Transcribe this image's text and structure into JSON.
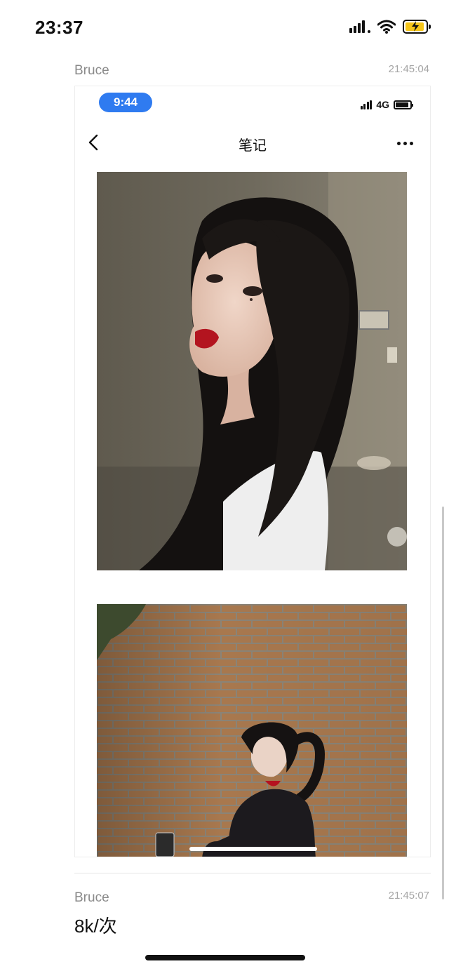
{
  "status_bar": {
    "time": "23:37"
  },
  "messages": [
    {
      "sender": "Bruce",
      "time": "21:45:04"
    },
    {
      "sender": "Bruce",
      "time": "21:45:07",
      "text": "8k/次"
    }
  ],
  "shared_screenshot": {
    "status_time": "9:44",
    "network": "4G",
    "nav_title": "笔记"
  },
  "colors": {
    "pill": "#2f7bf0",
    "battery_charging": "#f5c518"
  },
  "icons": [
    "signal-icon",
    "wifi-icon",
    "battery-charging-icon",
    "back-chevron-icon",
    "more-icon"
  ]
}
